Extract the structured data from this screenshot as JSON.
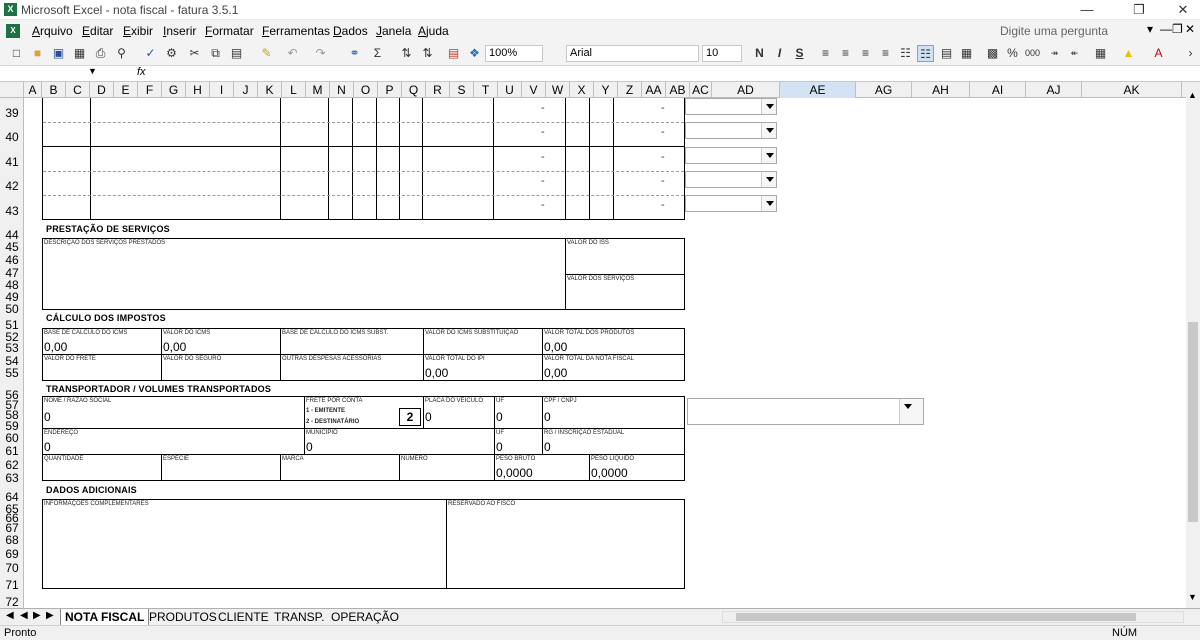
{
  "window": {
    "title": "Microsoft Excel - nota fiscal - fatura 3.5.1",
    "app_icon": "excel-icon"
  },
  "menu": {
    "items": [
      "Arquivo",
      "Editar",
      "Exibir",
      "Inserir",
      "Formatar",
      "Ferramentas",
      "Dados",
      "Janela",
      "Ajuda"
    ],
    "question_placeholder": "Digite uma pergunta"
  },
  "toolbar": {
    "zoom": "100%",
    "font": "Arial",
    "font_size": "10",
    "bold": "N",
    "italic": "I",
    "underline": "S",
    "percent": "%",
    "thousands": "000"
  },
  "formula": {
    "fx_label": "fx"
  },
  "columns": [
    "A",
    "B",
    "C",
    "D",
    "E",
    "F",
    "G",
    "H",
    "I",
    "J",
    "K",
    "L",
    "M",
    "N",
    "O",
    "P",
    "Q",
    "R",
    "S",
    "T",
    "U",
    "V",
    "W",
    "X",
    "Y",
    "Z",
    "AA",
    "AB",
    "AC",
    "AD",
    "AE",
    "AG",
    "AH",
    "AI",
    "AJ",
    "AK"
  ],
  "selected_column": "AE",
  "rows": [
    "39",
    "40",
    "41",
    "42",
    "43",
    "44",
    "45",
    "46",
    "47",
    "48",
    "49",
    "50",
    "51",
    "52",
    "53",
    "54",
    "55",
    "56",
    "57",
    "58",
    "59",
    "60",
    "61",
    "62",
    "63",
    "64",
    "65",
    "66",
    "67",
    "68",
    "69",
    "70",
    "71",
    "72"
  ],
  "products_dash": "-",
  "services": {
    "title": "PRESTAÇÃO DE SERVIÇOS",
    "desc_label": "DESCRIÇÃO DOS SERVIÇOS PRESTADOS",
    "iss_label": "VALOR DO ISS",
    "services_value_label": "VALOR DOS SERVIÇOS"
  },
  "taxes": {
    "title": "CÁLCULO DOS IMPOSTOS",
    "base_icms_label": "BASE DE CÁLCULO DO ICMS",
    "base_icms_value": "0,00",
    "icms_label": "VALOR DO ICMS",
    "icms_value": "0,00",
    "base_subst_label": "BASE DE CÁLCULO DO ICMS SUBST.",
    "icms_subst_label": "VALOR DO ICMS SUBSTITUIÇÃO",
    "total_products_label": "VALOR TOTAL DOS PRODUTOS",
    "total_products_value": "0,00",
    "freight_label": "VALOR DO FRETE",
    "insurance_label": "VALOR DO SEGURO",
    "other_label": "OUTRAS DESPESAS ACESSÓRIAS",
    "ipi_label": "VALOR TOTAL DO IPI",
    "ipi_value": "0,00",
    "total_invoice_label": "VALOR TOTAL DA NOTA FISCAL",
    "total_invoice_value": "0,00"
  },
  "carrier": {
    "title": "TRANSPORTADOR / VOLUMES TRANSPORTADOS",
    "name_label": "NOME / RAZÃO SOCIAL",
    "name_value": "0",
    "freight_label": "FRETE POR CONTA",
    "freight_opt1": "1 - EMITENTE",
    "freight_opt2": "2 - DESTINATÁRIO",
    "freight_value": "2",
    "plate_label": "PLACA DO VEÍCULO",
    "plate_value": "0",
    "uf_label": "UF",
    "uf_value": "0",
    "cpf_label": "CPF / CNPJ",
    "cpf_value": "0",
    "address_label": "ENDEREÇO",
    "address_value": "0",
    "city_label": "MUNICÍPIO",
    "city_value": "0",
    "uf2_label": "UF",
    "uf2_value": "0",
    "ie_label": "RG / INSCRIÇÃO ESTADUAL",
    "ie_value": "0",
    "qty_label": "QUANTIDADE",
    "kind_label": "ESPÉCIE",
    "brand_label": "MARCA",
    "number_label": "NÚMERO",
    "gross_label": "PESO BRUTO",
    "gross_value": "0,0000",
    "net_label": "PESO LÍQUIDO",
    "net_value": "0,0000"
  },
  "additional": {
    "title": "DADOS ADICIONAIS",
    "info_label": "INFORMAÇÕES COMPLEMENTARES",
    "fisco_label": "RESERVADO AO FISCO"
  },
  "tabs": [
    "NOTA FISCAL",
    "PRODUTOS",
    "CLIENTE",
    "TRANSP.",
    "OPERAÇÃO"
  ],
  "active_tab": "NOTA FISCAL",
  "status": {
    "left": "Pronto",
    "right": "NÚM"
  }
}
